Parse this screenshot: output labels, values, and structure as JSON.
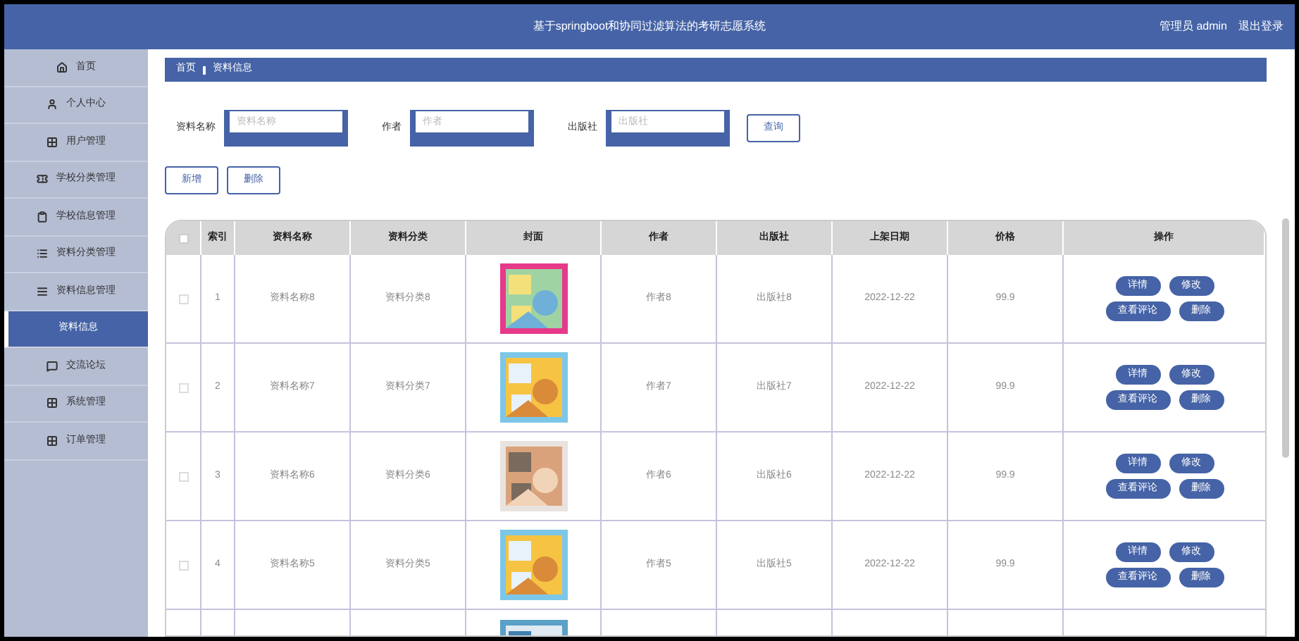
{
  "header": {
    "title": "基于springboot和协同过滤算法的考研志愿系统",
    "user": "管理员 admin",
    "logout": "退出登录"
  },
  "sidebar": {
    "items": [
      {
        "label": "首页",
        "selected": false
      },
      {
        "label": "个人中心",
        "selected": false
      },
      {
        "label": "用户管理",
        "selected": false
      },
      {
        "label": "学校分类管理",
        "selected": false
      },
      {
        "label": "学校信息管理",
        "selected": false
      },
      {
        "label": "资料分类管理",
        "selected": false
      },
      {
        "label": "资料信息管理",
        "selected": false
      },
      {
        "label": "资料信息",
        "selected": true
      },
      {
        "label": "交流论坛",
        "selected": false
      },
      {
        "label": "系统管理",
        "selected": false
      },
      {
        "label": "订单管理",
        "selected": false
      }
    ]
  },
  "breadcrumb": [
    "首页",
    "资料信息"
  ],
  "search": {
    "fields": [
      {
        "label": "资料名称",
        "placeholder": "资料名称"
      },
      {
        "label": "作者",
        "placeholder": "作者"
      },
      {
        "label": "出版社",
        "placeholder": "出版社"
      }
    ],
    "button": "查询"
  },
  "actions": [
    "新增",
    "删除"
  ],
  "table": {
    "select_all_checked": false,
    "columns": [
      "索引",
      "资料名称",
      "资料分类",
      "封面",
      "作者",
      "出版社",
      "上架日期",
      "价格",
      "操作"
    ],
    "rows": [
      {
        "checked": false,
        "cells": [
          "1",
          "资料名称8",
          "资料分类8",
          {
            "kind": "picture"
          },
          "作者8",
          "出版社8",
          "2022-12-22",
          "99.9"
        ],
        "buttons": [
          "详情",
          "修改",
          "查看评论",
          "删除"
        ]
      },
      {
        "checked": false,
        "cells": [
          "2",
          "资料名称7",
          "资料分类7",
          {
            "kind": "picture"
          },
          "作者7",
          "出版社7",
          "2022-12-22",
          "99.9"
        ],
        "buttons": [
          "详情",
          "修改",
          "查看评论",
          "删除"
        ]
      },
      {
        "checked": false,
        "cells": [
          "3",
          "资料名称6",
          "资料分类6",
          {
            "kind": "picture"
          },
          "作者6",
          "出版社6",
          "2022-12-22",
          "99.9"
        ],
        "buttons": [
          "详情",
          "修改",
          "查看评论",
          "删除"
        ]
      },
      {
        "checked": false,
        "cells": [
          "4",
          "资料名称5",
          "资料分类5",
          {
            "kind": "picture"
          },
          "作者5",
          "出版社5",
          "2022-12-22",
          "99.9"
        ],
        "buttons": [
          "详情",
          "修改",
          "查看评论",
          "删除"
        ]
      }
    ]
  }
}
